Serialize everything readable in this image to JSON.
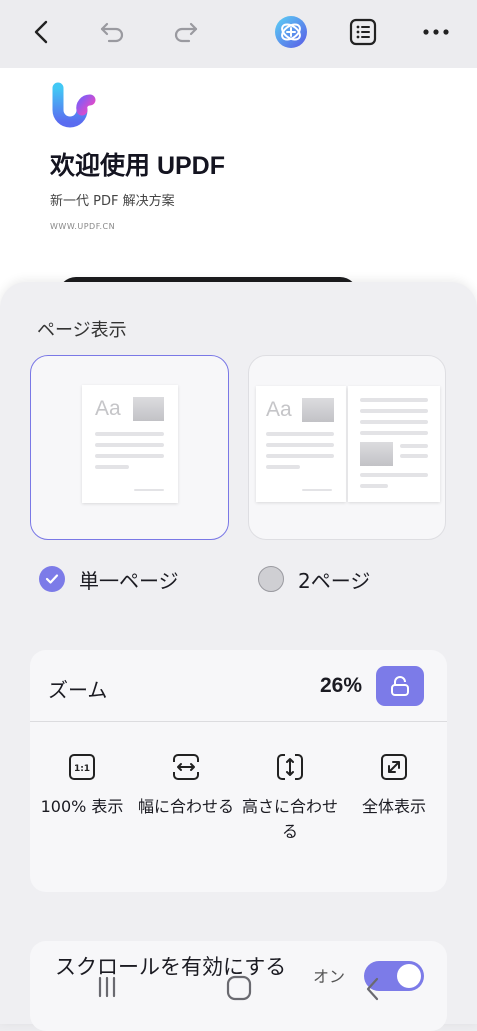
{
  "toolbar": {
    "icons": [
      "back-icon",
      "undo-icon",
      "redo-icon",
      "ai-assistant-icon",
      "outline-list-icon",
      "more-icon"
    ]
  },
  "document": {
    "title": "欢迎使用 UPDF",
    "subtitle": "新一代 PDF 解决方案",
    "url": "WWW.UPDF.CN"
  },
  "page_display": {
    "label": "ページ表示",
    "options": [
      {
        "label": "単一ページ",
        "selected": true
      },
      {
        "label": "2ページ",
        "selected": false
      }
    ],
    "thumb_text": "Aa"
  },
  "zoom": {
    "label": "ズーム",
    "value": "26%",
    "options": [
      {
        "label": "100% 表示",
        "icon": "actual-size-icon",
        "badge": "1:1"
      },
      {
        "label": "幅に合わせる",
        "icon": "fit-width-icon"
      },
      {
        "label": "高さに合わせる",
        "icon": "fit-height-icon"
      },
      {
        "label": "全体表示",
        "icon": "fit-page-icon"
      }
    ]
  },
  "scroll": {
    "label": "スクロールを有効にする",
    "state_label": "オン",
    "enabled": true
  },
  "colors": {
    "accent": "#7c7be8",
    "background": "#ececef"
  }
}
